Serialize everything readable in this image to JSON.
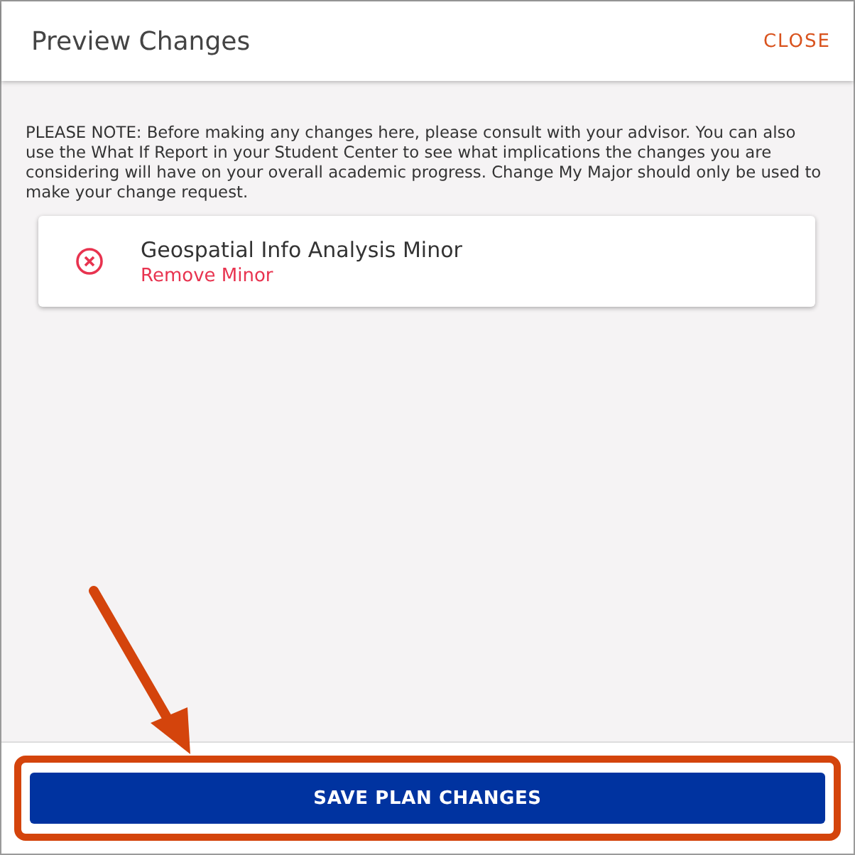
{
  "dialog": {
    "title": "Preview Changes",
    "close_label": "CLOSE"
  },
  "notice": "PLEASE NOTE: Before making any changes here, please consult with your advisor. You can also use the What If Report in your Student Center to see what implications the changes you are considering will have on your overall academic progress. Change My Major should only be used to make your change request.",
  "changes": [
    {
      "kind": "remove",
      "name": "Geospatial Info Analysis Minor",
      "action": "Remove Minor"
    }
  ],
  "footer": {
    "button": "SAVE PLAN CHANGES",
    "highlighted": true
  }
}
